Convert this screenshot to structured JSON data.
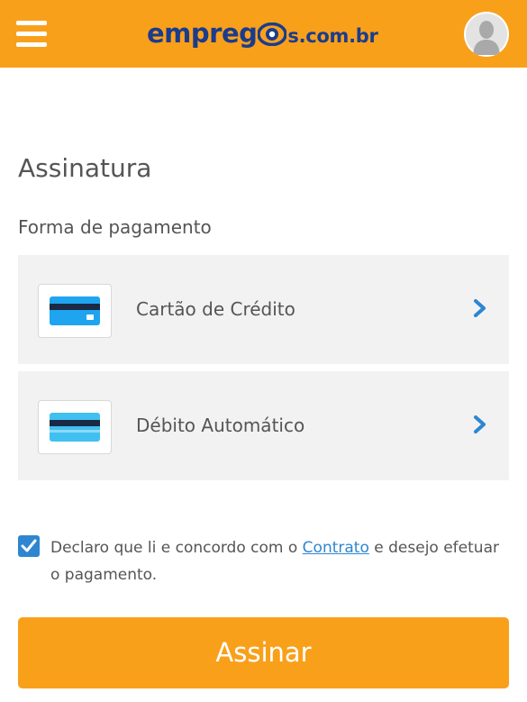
{
  "header": {
    "menu_icon": "hamburger-menu-icon",
    "logo": {
      "part1": "empreg",
      "part2": "s.com.br",
      "eye_icon": "eye-icon"
    },
    "avatar_icon": "user-silhouette-icon"
  },
  "main": {
    "title": "Assinatura",
    "section_label": "Forma de pagamento",
    "payment_options": [
      {
        "label": "Cartão de Crédito",
        "icon": "credit-card-icon",
        "card_color": "#1fa4f0"
      },
      {
        "label": "Débito Automático",
        "icon": "debit-card-icon",
        "card_color": "#40c0f0"
      }
    ],
    "agreement": {
      "checked": true,
      "text_before": "Declaro que li e concordo com o ",
      "link": "Contrato",
      "text_after": " e desejo efetuar o pagamento."
    },
    "submit_label": "Assinar"
  },
  "colors": {
    "brand_orange": "#f9a01b",
    "logo_blue": "#1b3c8c",
    "accent_blue": "#2e86d1",
    "panel_gray": "#f2f2f2"
  }
}
